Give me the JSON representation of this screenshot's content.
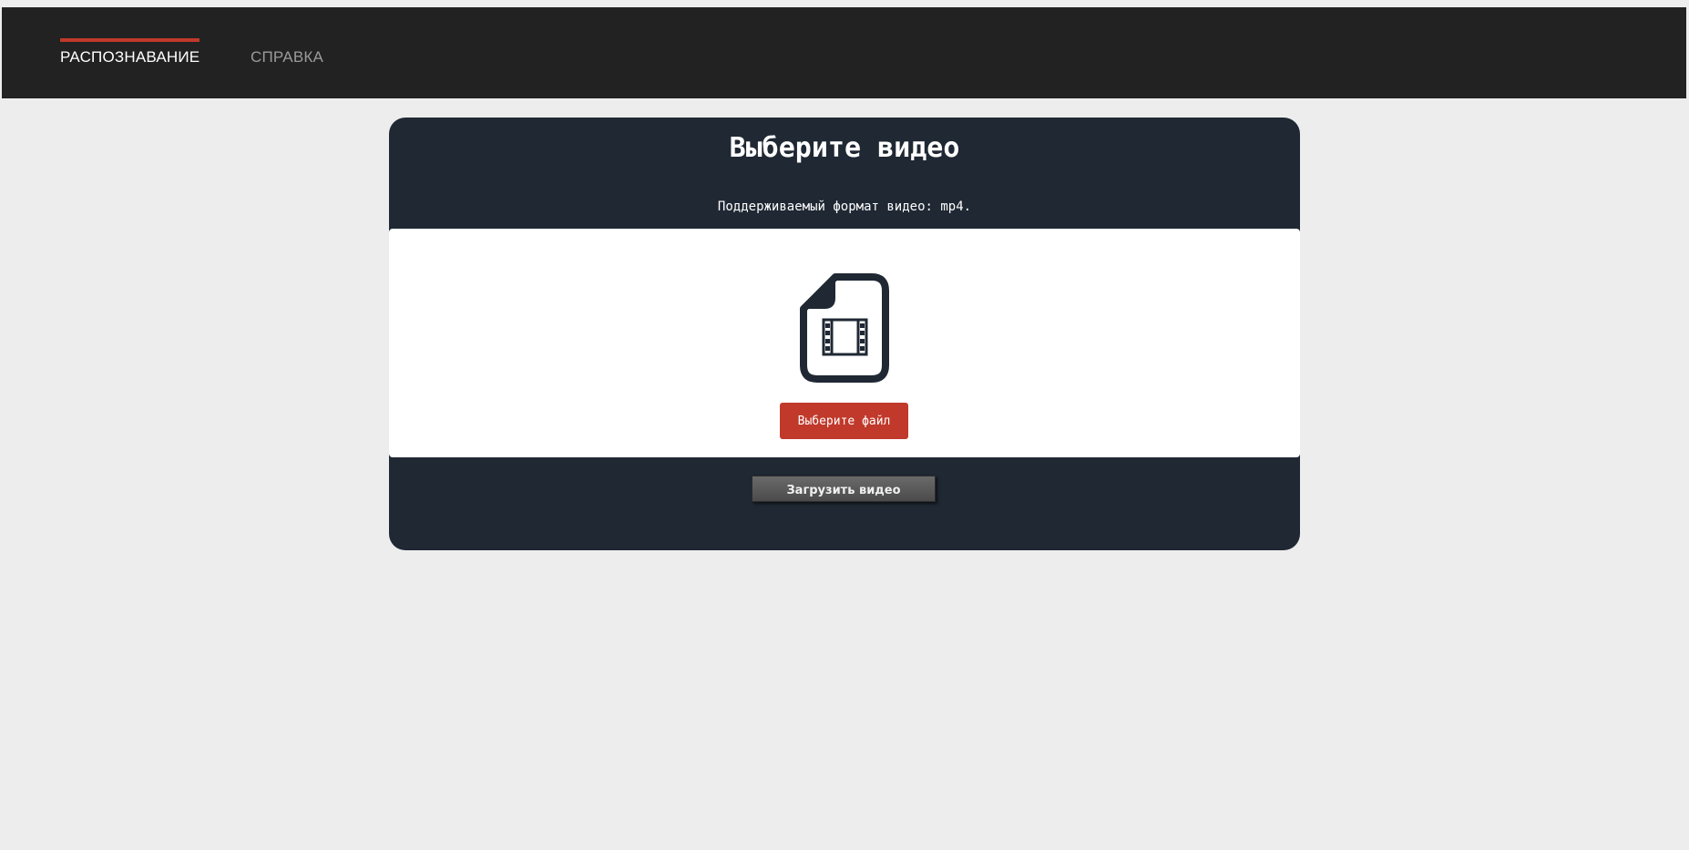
{
  "nav": {
    "items": [
      {
        "label": "РАСПОЗНАВАНИЕ",
        "active": true
      },
      {
        "label": "СПРАВКА",
        "active": false
      }
    ],
    "accent_color": "#c0392b"
  },
  "upload_card": {
    "title": "Выберите видео",
    "subtitle": "Поддерживаемый формат видео: mp4.",
    "file_icon": "video-file-icon",
    "choose_file_label": "Выберите файл",
    "upload_label": "Загрузить видео"
  },
  "colors": {
    "topbar": "#222222",
    "card": "#1f2833",
    "choose_button": "#c0392b",
    "page_background": "#ededed"
  }
}
